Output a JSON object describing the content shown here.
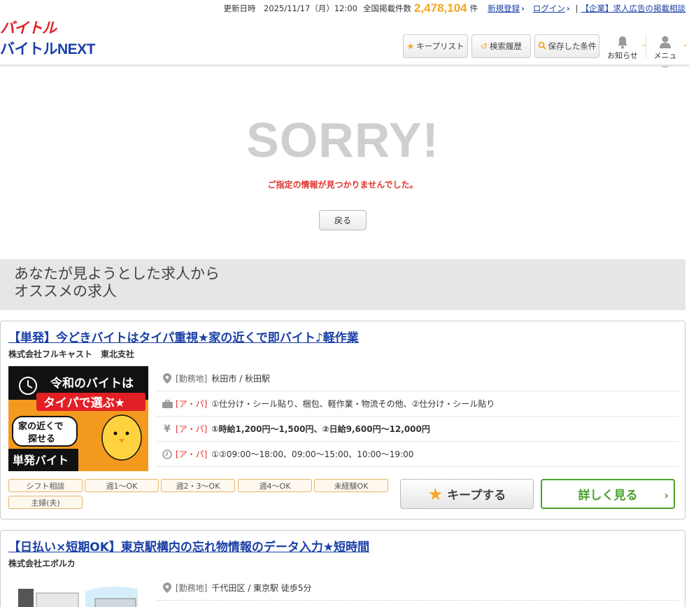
{
  "topbar": {
    "updated_label": "更新日時",
    "updated_value": "2025/11/17（月）12:00",
    "count_label": "全国掲載件数",
    "count_value": "2,478,104",
    "count_unit": "件",
    "register": "新規登録",
    "login": "ログイン",
    "corp_link": "【企業】求人広告の掲載相談"
  },
  "logo": {
    "line1": "バイトル",
    "line2": "バイトルNEXT"
  },
  "header": {
    "keep_list": "キープリスト",
    "history": "検索履歴",
    "saved": "保存した条件",
    "notify": "お知らせ",
    "menu": "メニュー"
  },
  "error": {
    "big": "SORRY!",
    "message": "ご指定の情報が見つかりませんでした。",
    "back": "戻る"
  },
  "recommend": {
    "line1": "あなたが見ようとした求人から",
    "line2": "オススメの求人"
  },
  "jobs": [
    {
      "title": "【単発】今どきバイトはタイパ重視★家の近くで即バイト♪軽作業",
      "company": "株式会社フルキャスト　東北支社",
      "thumb_text": {
        "l1": "令和のバイトは",
        "l2": "タイパで選ぶ★",
        "l3": "家の近くで",
        "l4": "探せる",
        "l5": "単発バイト"
      },
      "location_label": "[勤務地]",
      "location": "秋田市 / 秋田駅",
      "work_label": "[ア・パ]",
      "work": "①仕分け・シール貼り、梱包、軽作業・物流その他、②仕分け・シール貼り",
      "pay_label": "[ア・パ]",
      "pay": "①時給1,200円～1,500円、②日給9,600円～12,000円",
      "time_label": "[ア・パ]",
      "time": "①②09:00～18:00、09:00～15:00、10:00～19:00",
      "tags": [
        "シフト相談",
        "週1～OK",
        "週2・3～OK",
        "週4～OK",
        "未経験OK",
        "主婦(夫)"
      ],
      "keep": "キープする",
      "detail": "詳しく見る"
    },
    {
      "title": "【日払い×短期OK】東京駅構内の忘れ物情報のデータ入力★短時間",
      "company": "株式会社エボルカ",
      "location_label": "[勤務地]",
      "location": "千代田区 / 東京駅 徒歩5分"
    }
  ],
  "colors": {
    "brand_red": "#e31f26",
    "brand_blue": "#1a3fa6",
    "accent_orange": "#f5a623",
    "detail_green": "#4aa22c",
    "error_red": "#e0342f"
  }
}
